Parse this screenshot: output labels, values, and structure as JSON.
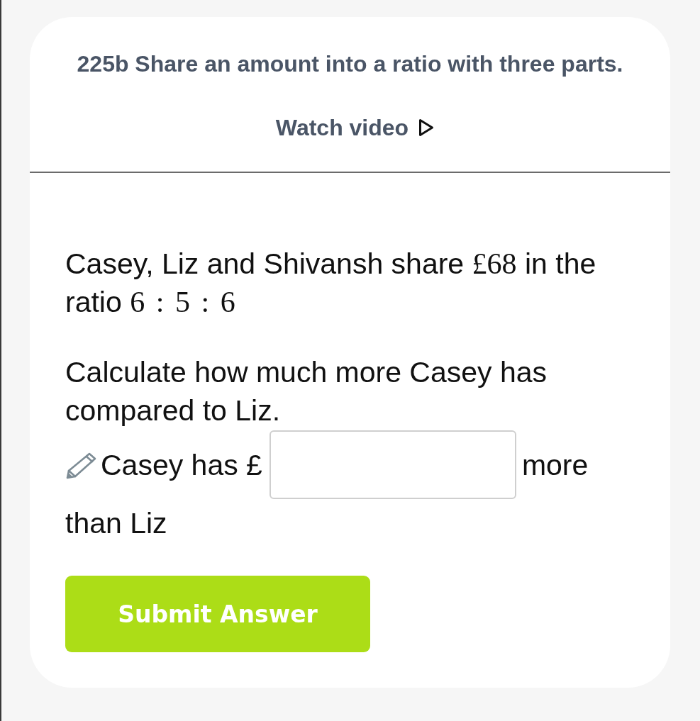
{
  "title": "225b Share an amount into a ratio with three parts.",
  "watch_video": {
    "label": "Watch video"
  },
  "question": [
    [
      {
        "kind": "text",
        "text": "Casey, Liz and Shivansh share "
      },
      {
        "kind": "math",
        "text": "£68"
      },
      {
        "kind": "text",
        "text": " in the ratio "
      },
      {
        "kind": "math",
        "text": "6 : 5 : 6"
      }
    ],
    [
      {
        "kind": "text",
        "text": "Calculate how much more Casey has compared to Liz."
      }
    ]
  ],
  "answer": {
    "prefix": "Casey has £",
    "suffix_lines": [
      "more",
      "than Liz"
    ]
  },
  "submit": {
    "label": "Submit Answer"
  }
}
